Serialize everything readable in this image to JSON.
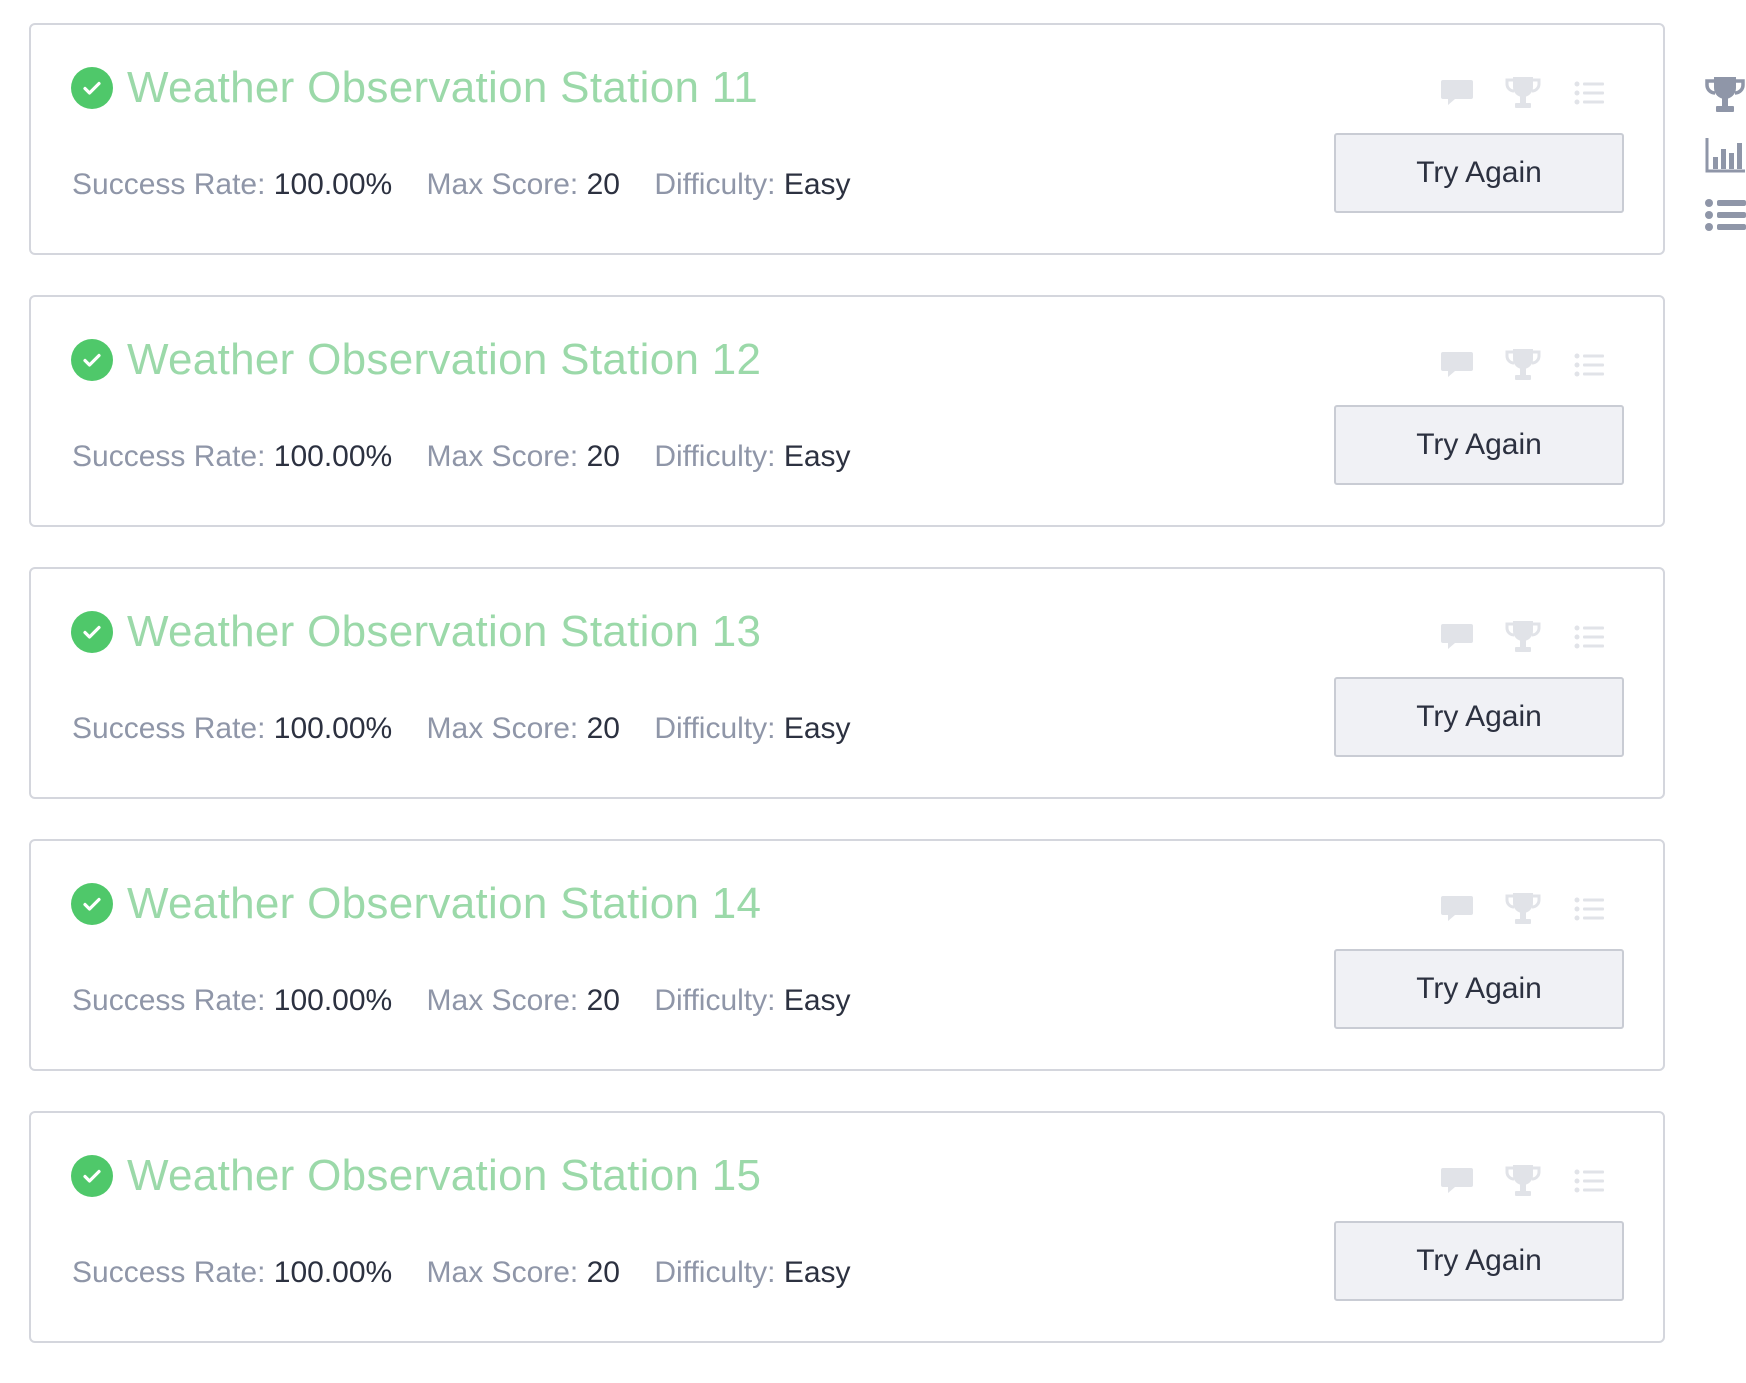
{
  "challenges": [
    {
      "title": "Weather Observation Station 11",
      "success_rate_label": "Success Rate:",
      "success_rate": "100.00%",
      "max_score_label": "Max Score:",
      "max_score": "20",
      "difficulty_label": "Difficulty:",
      "difficulty": "Easy",
      "button_label": "Try Again"
    },
    {
      "title": "Weather Observation Station 12",
      "success_rate_label": "Success Rate:",
      "success_rate": "100.00%",
      "max_score_label": "Max Score:",
      "max_score": "20",
      "difficulty_label": "Difficulty:",
      "difficulty": "Easy",
      "button_label": "Try Again"
    },
    {
      "title": "Weather Observation Station 13",
      "success_rate_label": "Success Rate:",
      "success_rate": "100.00%",
      "max_score_label": "Max Score:",
      "max_score": "20",
      "difficulty_label": "Difficulty:",
      "difficulty": "Easy",
      "button_label": "Try Again"
    },
    {
      "title": "Weather Observation Station 14",
      "success_rate_label": "Success Rate:",
      "success_rate": "100.00%",
      "max_score_label": "Max Score:",
      "max_score": "20",
      "difficulty_label": "Difficulty:",
      "difficulty": "Easy",
      "button_label": "Try Again"
    },
    {
      "title": "Weather Observation Station 15",
      "success_rate_label": "Success Rate:",
      "success_rate": "100.00%",
      "max_score_label": "Max Score:",
      "max_score": "20",
      "difficulty_label": "Difficulty:",
      "difficulty": "Easy",
      "button_label": "Try Again"
    }
  ],
  "card_icons": [
    "discussion-icon",
    "trophy-icon",
    "list-icon"
  ],
  "sidebar_icons": [
    "trophy-icon",
    "bar-chart-icon",
    "list-icon"
  ],
  "colors": {
    "solved_check": "#4fc86a",
    "title": "#9bd9a9",
    "label": "#8f96a8",
    "value": "#2c3140",
    "card_icon": "#e1e3e8",
    "sidebar_icon": "#8f96a8"
  }
}
